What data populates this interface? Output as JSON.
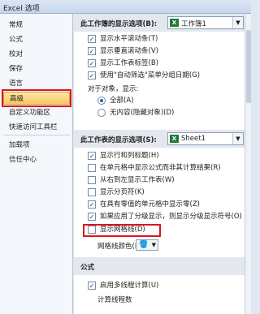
{
  "window": {
    "title": "Excel 选项"
  },
  "sidebar": {
    "items": [
      {
        "label": "常规"
      },
      {
        "label": "公式"
      },
      {
        "label": "校对"
      },
      {
        "label": "保存"
      },
      {
        "label": "语言"
      },
      {
        "label": "高级",
        "selected": true
      },
      {
        "label": "自定义功能区"
      },
      {
        "label": "快速访问工具栏"
      },
      {
        "label": "加载项"
      },
      {
        "label": "信任中心"
      }
    ]
  },
  "workbook_section": {
    "title": "此工作簿的显示选项(B):",
    "combo_value": "工作簿1",
    "options": [
      {
        "label": "显示水平滚动条(T)",
        "checked": true
      },
      {
        "label": "显示垂直滚动条(V)",
        "checked": true
      },
      {
        "label": "显示工作表标签(B)",
        "checked": true
      },
      {
        "label": "使用\"自动筛选\"菜单分组日期(G)",
        "checked": true
      }
    ],
    "objects_label": "对于对象，显示:",
    "radios": [
      {
        "label": "全部(A)",
        "selected": true
      },
      {
        "label": "无内容(隐藏对象)(D)",
        "selected": false
      }
    ]
  },
  "sheet_section": {
    "title": "此工作表的显示选项(S):",
    "combo_value": "Sheet1",
    "options": [
      {
        "label": "显示行和列标题(H)",
        "checked": true
      },
      {
        "label": "在单元格中显示公式而非其计算结果(R)",
        "checked": false
      },
      {
        "label": "从右到左显示工作表(W)",
        "checked": false
      },
      {
        "label": "显示分页符(K)",
        "checked": false
      },
      {
        "label": "在具有零值的单元格中显示零(Z)",
        "checked": true
      },
      {
        "label": "如果应用了分级显示，则显示分级显示符号(O)",
        "checked": true
      },
      {
        "label": "显示网格线(D)",
        "checked": false
      }
    ],
    "gridline_color_label": "网格线颜色(D)"
  },
  "formula_section": {
    "title": "公式",
    "options": [
      {
        "label": "启用多线程计算(U)",
        "checked": true
      }
    ],
    "threads_label": "计算线程数"
  },
  "colors": {
    "selected_nav": "#f7c95f",
    "highlight": "#e0141d",
    "check": "#1d3f73"
  }
}
